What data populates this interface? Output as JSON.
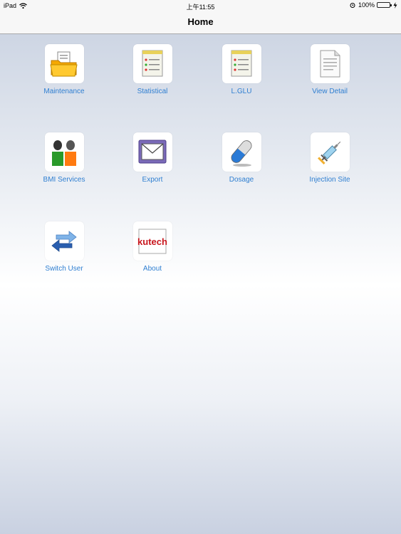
{
  "status_bar": {
    "carrier": "iPad",
    "time": "上午11:55",
    "battery": "100%",
    "icons": [
      "wifi-icon",
      "alarm-icon",
      "battery-icon",
      "charging-icon"
    ]
  },
  "nav": {
    "title": "Home"
  },
  "menu": [
    {
      "label": "Maintenance",
      "icon": "folder-icon"
    },
    {
      "label": "Statistical",
      "icon": "notepad-icon"
    },
    {
      "label": "L.GLU",
      "icon": "notepad-icon"
    },
    {
      "label": "View Detail",
      "icon": "document-icon"
    },
    {
      "label": "BMI Services",
      "icon": "people-icon"
    },
    {
      "label": "Export",
      "icon": "envelope-icon"
    },
    {
      "label": "Dosage",
      "icon": "pill-icon"
    },
    {
      "label": "Injection Site",
      "icon": "syringe-icon"
    },
    {
      "label": "Switch User",
      "icon": "swap-arrows-icon"
    },
    {
      "label": "About",
      "icon": "logo-icon",
      "logo_text": "kutech"
    }
  ],
  "colors": {
    "label": "#2f7fd1",
    "bar": "#f7f7f7"
  }
}
